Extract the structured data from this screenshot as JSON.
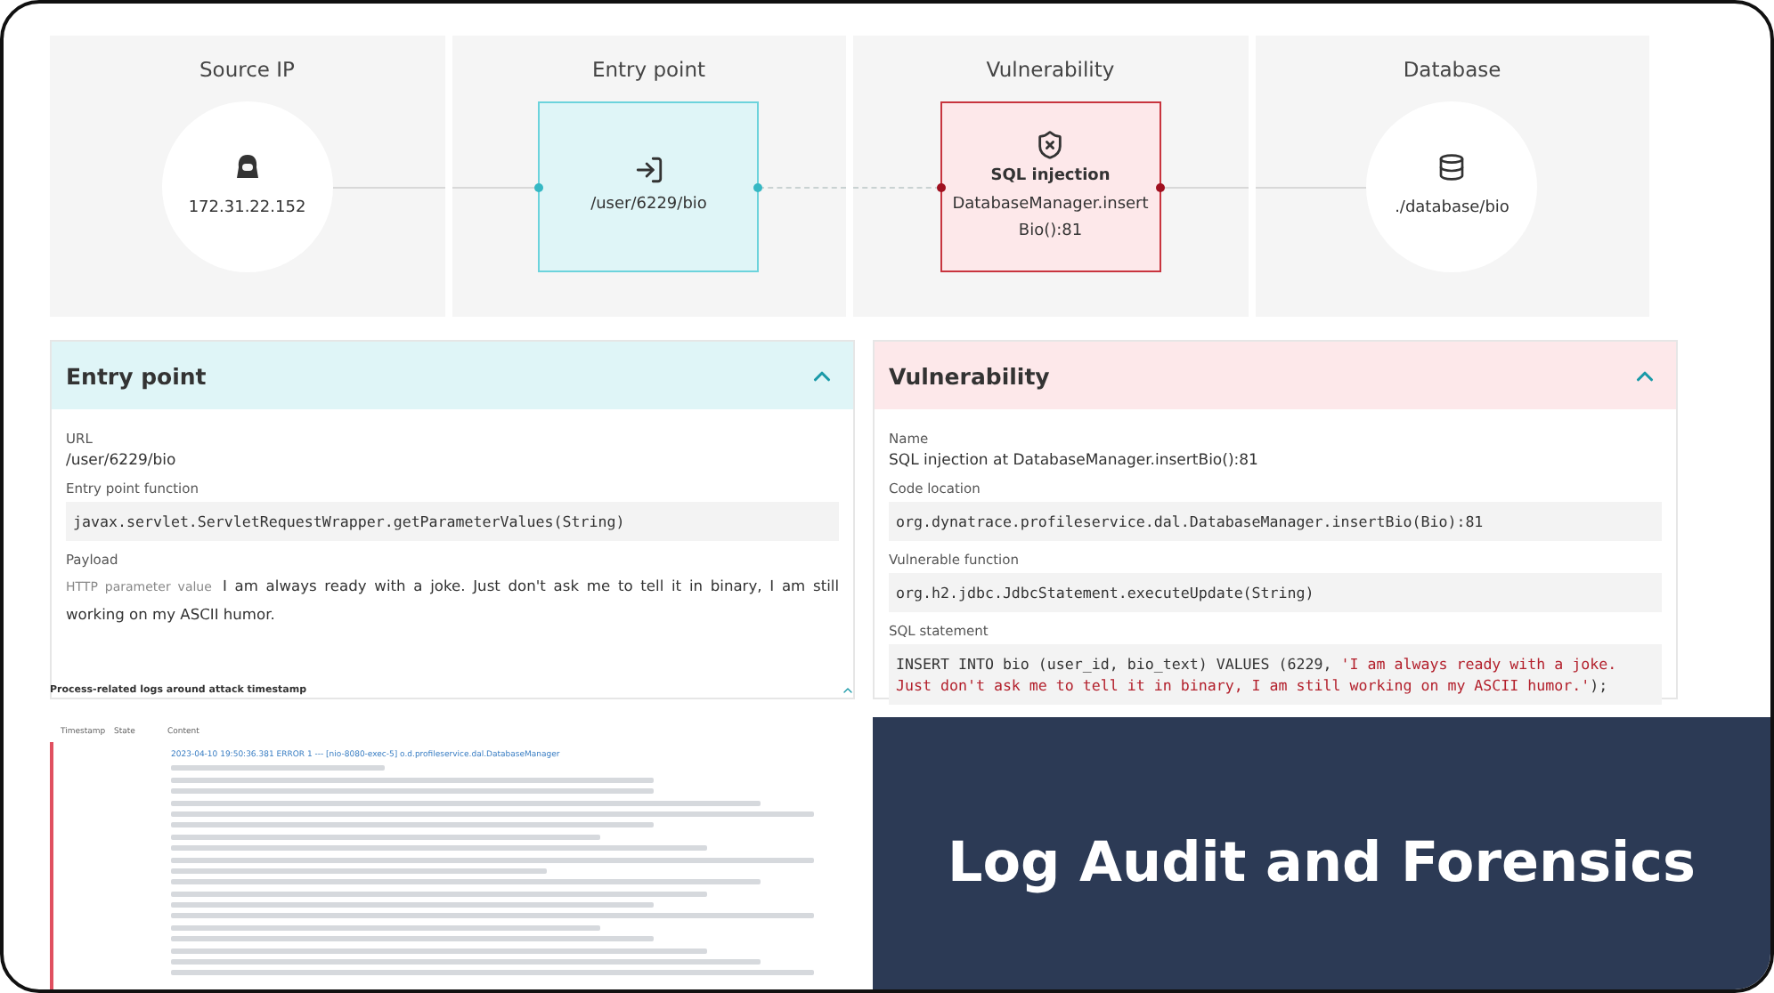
{
  "flow": {
    "stages": [
      {
        "title": "Source IP",
        "kind": "circle",
        "label": "172.31.22.152"
      },
      {
        "title": "Entry point",
        "kind": "box",
        "label": "/user/6229/bio"
      },
      {
        "title": "Vulnerability",
        "kind": "box",
        "heading": "SQL injection",
        "label": "DatabaseManager.insertBio():81"
      },
      {
        "title": "Database",
        "kind": "circle",
        "label": "./database/bio"
      }
    ]
  },
  "panels": [
    {
      "title": "Entry point",
      "kind": "entry",
      "expanded": true,
      "fields": [
        {
          "label": "URL",
          "kind": "text",
          "value": "/user/6229/bio"
        },
        {
          "label": "Entry point function",
          "kind": "code",
          "value": "javax.servlet.ServletRequestWrapper.getParameterValues(String)"
        },
        {
          "label": "Payload",
          "kind": "payload",
          "hint": "HTTP parameter value",
          "value": "I am always ready with a joke. Just don't ask me to tell it in binary, I am still working on my ASCII humor."
        }
      ]
    },
    {
      "title": "Vulnerability",
      "kind": "vuln",
      "expanded": true,
      "fields": [
        {
          "label": "Name",
          "kind": "text",
          "value": "SQL injection at DatabaseManager.insertBio():81"
        },
        {
          "label": "Code location",
          "kind": "code",
          "value": "org.dynatrace.profileservice.dal.DatabaseManager.insertBio(Bio):81"
        },
        {
          "label": "Vulnerable function",
          "kind": "code",
          "value": "org.h2.jdbc.JdbcStatement.executeUpdate(String)"
        },
        {
          "label": "SQL statement",
          "kind": "sql",
          "parts": [
            {
              "kind": "plain",
              "text": "INSERT INTO bio (user_id, bio_text) VALUES (6229, "
            },
            {
              "kind": "injected",
              "text": "'I am always ready with a joke. Just don't ask me to tell it in binary, I am still working on my ASCII humor.'"
            },
            {
              "kind": "plain",
              "text": ");"
            }
          ]
        }
      ]
    }
  ],
  "logs": {
    "title": "Process-related logs around attack timestamp",
    "expanded": true,
    "columns": [
      "Timestamp",
      "State",
      "Content"
    ],
    "entry": {
      "kind": "error",
      "head": "2023-04-10 19:50:36.381 ERROR 1 --- [nio-8080-exec-5] o.d.profileservice.dal.DatabaseManager"
    }
  },
  "banner": {
    "title": "Log Audit and Forensics"
  }
}
